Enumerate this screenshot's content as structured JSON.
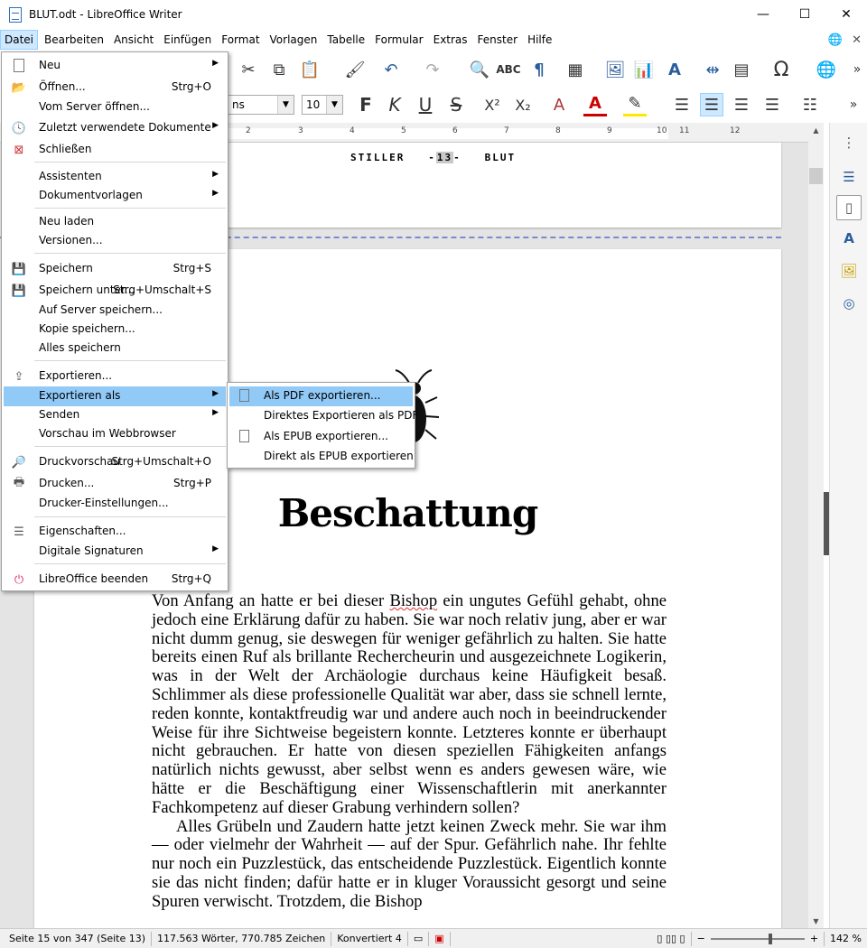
{
  "window": {
    "title": "BLUT.odt - LibreOffice Writer",
    "minimize": "—",
    "maximize": "☐",
    "close": "✕"
  },
  "menubar": [
    "Datei",
    "Bearbeiten",
    "Ansicht",
    "Einfügen",
    "Format",
    "Vorlagen",
    "Tabelle",
    "Formular",
    "Extras",
    "Fenster",
    "Hilfe"
  ],
  "toolbar": {
    "font_name": "ns",
    "font_size": "10"
  },
  "ruler": [
    "2",
    "1",
    "2",
    "3",
    "4",
    "5",
    "6",
    "7",
    "8",
    "9",
    "10",
    "11",
    "12"
  ],
  "document": {
    "header_left": "STILLER",
    "page_number": "13",
    "header_right": "BLUT",
    "chapter_title": "Beschattung",
    "para1_a": "Von Anfang an hatte er bei dieser ",
    "para1_flag": "Bishop",
    "para1_b": " ein ungutes Gefühl gehabt, ohne jedoch eine Erklärung dafür zu haben. Sie war noch relativ jung, aber er war nicht dumm genug, sie deswegen für weniger gefährlich zu halten. Sie hatte bereits einen Ruf als brillante Rechercheurin und ausgezeichnete Logikerin, was in der Welt der Archäologie durchaus keine Häufigkeit besaß. Schlimmer als diese professionelle Qualität war aber, dass sie schnell lernte, reden konnte, kontaktfreudig war und andere auch noch in beeindruckender Weise für ihre Sichtweise begeistern konnte. Letzteres konnte er überhaupt nicht gebrauchen. Er hatte von diesen speziellen Fähigkeiten anfangs natürlich nichts gewusst, aber selbst wenn es anders gewesen wäre, wie hätte er die Beschäftigung einer Wissenschaftlerin mit anerkannter Fachkompetenz auf dieser Grabung verhindern sollen?",
    "para2": "Alles Grübeln und Zaudern hatte jetzt keinen Zweck mehr. Sie war ihm — oder vielmehr der Wahrheit — auf der Spur. Gefährlich nahe. Ihr fehlte nur noch ein Puzzlestück, das entscheidende Puzzlestück. Eigentlich konnte sie das nicht finden; dafür hatte er in kluger Voraussicht gesorgt und seine Spuren verwischt. Trotzdem, die Bishop"
  },
  "file_menu": {
    "items": [
      {
        "label": "Neu",
        "shortcut": "",
        "submenu": true,
        "icon": "new-doc-icon"
      },
      {
        "label": "Öffnen...",
        "shortcut": "Strg+O",
        "submenu": false,
        "icon": "folder-icon"
      },
      {
        "label": "Vom Server öffnen...",
        "shortcut": "",
        "submenu": false,
        "icon": ""
      },
      {
        "label": "Zuletzt verwendete Dokumente",
        "shortcut": "",
        "submenu": true,
        "icon": "clock-icon"
      },
      {
        "label": "Schließen",
        "shortcut": "",
        "submenu": false,
        "icon": "close-doc-icon"
      },
      {
        "label": "Assistenten",
        "shortcut": "",
        "submenu": true,
        "icon": ""
      },
      {
        "label": "Dokumentvorlagen",
        "shortcut": "",
        "submenu": true,
        "icon": ""
      },
      {
        "label": "Neu laden",
        "shortcut": "",
        "submenu": false,
        "icon": ""
      },
      {
        "label": "Versionen...",
        "shortcut": "",
        "submenu": false,
        "icon": ""
      },
      {
        "label": "Speichern",
        "shortcut": "Strg+S",
        "submenu": false,
        "icon": "save-icon"
      },
      {
        "label": "Speichern unter...",
        "shortcut": "Strg+Umschalt+S",
        "submenu": false,
        "icon": "save-as-icon"
      },
      {
        "label": "Auf Server speichern...",
        "shortcut": "",
        "submenu": false,
        "icon": ""
      },
      {
        "label": "Kopie speichern...",
        "shortcut": "",
        "submenu": false,
        "icon": ""
      },
      {
        "label": "Alles speichern",
        "shortcut": "",
        "submenu": false,
        "icon": ""
      },
      {
        "label": "Exportieren...",
        "shortcut": "",
        "submenu": false,
        "icon": "export-icon"
      },
      {
        "label": "Exportieren als",
        "shortcut": "",
        "submenu": true,
        "icon": ""
      },
      {
        "label": "Senden",
        "shortcut": "",
        "submenu": true,
        "icon": ""
      },
      {
        "label": "Vorschau im Webbrowser",
        "shortcut": "",
        "submenu": false,
        "icon": ""
      },
      {
        "label": "Druckvorschau",
        "shortcut": "Strg+Umschalt+O",
        "submenu": false,
        "icon": "print-preview-icon"
      },
      {
        "label": "Drucken...",
        "shortcut": "Strg+P",
        "submenu": false,
        "icon": "printer-icon"
      },
      {
        "label": "Drucker-Einstellungen...",
        "shortcut": "",
        "submenu": false,
        "icon": ""
      },
      {
        "label": "Eigenschaften...",
        "shortcut": "",
        "submenu": false,
        "icon": "properties-icon"
      },
      {
        "label": "Digitale Signaturen",
        "shortcut": "",
        "submenu": true,
        "icon": ""
      },
      {
        "label": "LibreOffice beenden",
        "shortcut": "Strg+Q",
        "submenu": false,
        "icon": "power-icon"
      }
    ]
  },
  "export_submenu": {
    "items": [
      {
        "label": "Als PDF exportieren...",
        "icon": "pdf-icon"
      },
      {
        "label": "Direktes Exportieren als PDF",
        "icon": ""
      },
      {
        "label": "Als EPUB exportieren...",
        "icon": "epub-icon"
      },
      {
        "label": "Direkt als EPUB exportieren",
        "icon": ""
      }
    ]
  },
  "status": {
    "page": "Seite 15 von 347 (Seite 13)",
    "words": "117.563 Wörter, 770.785 Zeichen",
    "style": "Konvertiert 4",
    "zoom": "142 %"
  }
}
